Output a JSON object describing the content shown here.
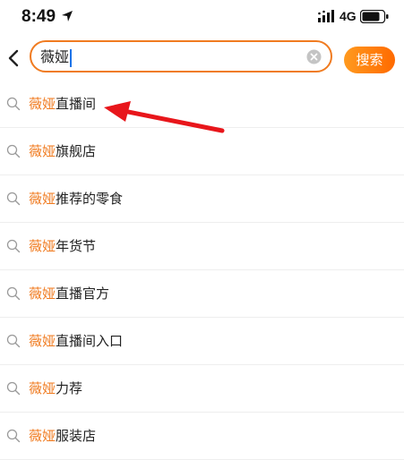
{
  "status_bar": {
    "time": "8:49",
    "network": "4G"
  },
  "search": {
    "query": "薇娅",
    "button_label": "搜索"
  },
  "suggestions": [
    {
      "highlight": "薇娅",
      "rest": "直播间"
    },
    {
      "highlight": "薇娅",
      "rest": "旗舰店"
    },
    {
      "highlight": "薇娅",
      "rest": "推荐的零食"
    },
    {
      "highlight": "薇娅",
      "rest": "年货节"
    },
    {
      "highlight": "薇娅",
      "rest": "直播官方"
    },
    {
      "highlight": "薇娅",
      "rest": "直播间入口"
    },
    {
      "highlight": "薇娅",
      "rest": "力荐"
    },
    {
      "highlight": "薇娅",
      "rest": "服装店"
    }
  ],
  "colors": {
    "accent": "#f07b20",
    "annotation": "#e8161b"
  },
  "icons": {
    "status": [
      "location-arrow-icon",
      "signal-icon",
      "battery-icon"
    ],
    "header": [
      "back-chevron-icon",
      "clear-icon"
    ],
    "list": "search-icon"
  }
}
